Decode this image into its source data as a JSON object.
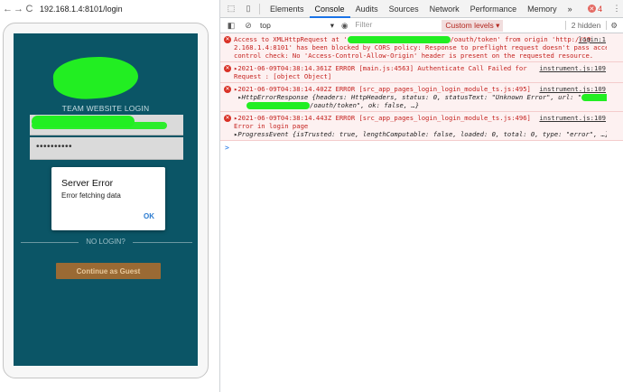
{
  "browser": {
    "url": "192.168.1.4:8101/login",
    "nav": {
      "back": "←",
      "forward": "→",
      "reload": "C"
    }
  },
  "app": {
    "title": "TEAM WEBSITE LOGIN",
    "password_value": "••••••••••",
    "dialog": {
      "title": "Server Error",
      "message": "Error fetching data",
      "ok_label": "OK"
    },
    "divider_text": "NO LOGIN?",
    "guest_button": "Continue as Guest",
    "colors": {
      "screen_bg": "#0b5566",
      "guest_btn": "#9a6a34",
      "redaction": "#22ee22"
    }
  },
  "devtools": {
    "tabs": [
      "Elements",
      "Console",
      "Audits",
      "Sources",
      "Network",
      "Performance",
      "Memory"
    ],
    "active_tab": "Console",
    "more_tabs": "»",
    "error_count": "4",
    "context": "top",
    "filter_placeholder": "Filter",
    "levels": "Custom levels ▾",
    "hidden": "2 hidden",
    "messages": [
      {
        "lines": [
          "Access to XMLHttpRequest at '",
          "2.168.1.4:8101' has been blocked by CORS policy: Response to preflight request doesn't pass access",
          "control check: No 'Access-Control-Allow-Origin' header is present on the requested resource."
        ],
        "line1_tail": "/oauth/token' from origin 'http://19",
        "source": "login:1"
      },
      {
        "lines": [
          "▸2021-06-09T04:38:14.361Z ERROR [main.js:4563] Authenticate Call Failed for",
          "Request : [object Object]"
        ],
        "source": "instrument.js:109"
      },
      {
        "lines": [
          "▸2021-06-09T04:38:14.402Z ERROR [src_app_pages_login_login_module_ts.js:495]",
          " ▸HttpErrorResponse {headers: HttpHeaders, status: 0, statusText: \"Unknown Error\", url: \"",
          "/oauth/token\", ok: false, …}"
        ],
        "source": "instrument.js:109"
      },
      {
        "lines": [
          "▸2021-06-09T04:38:14.443Z ERROR [src_app_pages_login_login_module_ts.js:496]",
          "Error in login page",
          "▸ProgressEvent {isTrusted: true, lengthComputable: false, loaded: 0, total: 0, type: \"error\", …}"
        ],
        "source": "instrument.js:109"
      }
    ],
    "prompt": ">"
  }
}
